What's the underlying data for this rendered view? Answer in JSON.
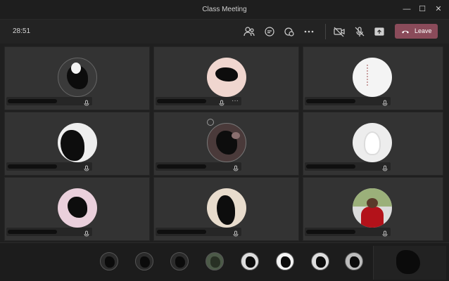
{
  "window": {
    "title": "Class Meeting",
    "minimize": "—",
    "maximize": "☐",
    "close": "✕"
  },
  "toolbar": {
    "timer": "28:51",
    "leave_label": "Leave",
    "icons": [
      "participants-icon",
      "chat-icon",
      "reactions-icon",
      "more-icon",
      "camera-off-icon",
      "mic-off-icon",
      "share-icon"
    ]
  },
  "colors": {
    "leave_button": "#8a4b5a",
    "tile_bg": "#333333",
    "avatar_peach": "#f0d6cf",
    "avatar_white": "#f4f4f4",
    "avatar_pink": "#ead0dc",
    "avatar_beige": "#e8dccd",
    "avatar_light": "#ededed"
  },
  "tiles": [
    {
      "avatar": "dark-photo",
      "more": ""
    },
    {
      "avatar": "peach",
      "more": "···"
    },
    {
      "avatar": "white",
      "more": ""
    },
    {
      "avatar": "white-photo",
      "more": ""
    },
    {
      "avatar": "photo",
      "more": ""
    },
    {
      "avatar": "light",
      "more": ""
    },
    {
      "avatar": "pink",
      "more": ""
    },
    {
      "avatar": "beige",
      "more": ""
    },
    {
      "avatar": "red-photo",
      "more": ""
    }
  ]
}
